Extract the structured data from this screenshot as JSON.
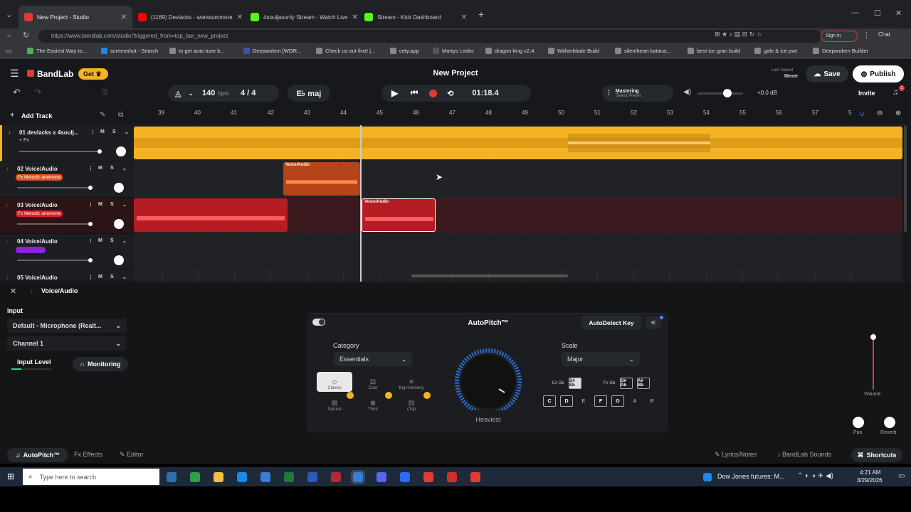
{
  "browser": {
    "tabs": [
      {
        "title": "New Project - Studio",
        "color": "#e53935",
        "active": true
      },
      {
        "title": "(1169) Devlacks - wantsummore",
        "color": "#ff0000"
      },
      {
        "title": "4souljasonly Stream - Watch Live",
        "color": "#53fc18"
      },
      {
        "title": "Stream - Kick Dashboard",
        "color": "#53fc18"
      }
    ],
    "url": "https://www.bandlab.com/studio?triggered_from=top_bar_new_project",
    "signin": "Sign in",
    "chat": "Chat",
    "bookmarks": [
      "The Easiest Way to...",
      "screenshot - Search",
      "to get auto tune b...",
      "Deepwoken [WOR...",
      "Check us out first! |...",
      "cety.app",
      "Martys Leaks",
      "dragon king v2.4",
      "Witherblade Build",
      "silentheart katana...",
      "best ice gran build",
      "gale & ice pve",
      "Deepwoken Builder"
    ]
  },
  "app": {
    "brand": "BandLab",
    "get_label": "Get",
    "project_title": "New Project",
    "last_saved_label": "Last Saved",
    "last_saved_value": "Never",
    "save_label": "Save",
    "publish_label": "Publish",
    "tempo": "140",
    "tempo_unit": "bpm",
    "time_sig": "4 / 4",
    "key": "E♭ maj",
    "time": "01:18.4",
    "mastering_title": "Mastering",
    "mastering_sub": "Select Preset",
    "master_db": "+0.0 dB",
    "invite_label": "Invite",
    "notif_count": "1",
    "add_track_label": "Add Track",
    "ruler": [
      "39",
      "40",
      "41",
      "42",
      "43",
      "44",
      "45",
      "46",
      "47",
      "48",
      "49",
      "50",
      "51",
      "52",
      "53",
      "54",
      "55",
      "56",
      "57",
      "5"
    ],
    "tracks": [
      {
        "name": "01 devlacks x 4soulj...",
        "fx": "+ Fx",
        "fx_color": "",
        "color": "#f5b324"
      },
      {
        "name": "02 Voice/Audio",
        "fx": "Fx Melodic anemone",
        "fx_color": "#e0531f",
        "color": "#e0531f"
      },
      {
        "name": "03 Voice/Audio",
        "fx": "Fx Melodic anemone",
        "fx_color": "#e01f2a",
        "color": "#e01f2a"
      },
      {
        "name": "04 Voice/Audio",
        "fx": "",
        "fx_color": "#8a24d8",
        "color": "#8a24d8"
      },
      {
        "name": "05 Voice/Audio",
        "fx": "",
        "fx_color": "",
        "color": "#2b7be0"
      }
    ],
    "clip_label": "Voice/Audio",
    "ms_m": "M",
    "ms_s": "S"
  },
  "panel": {
    "track_title": "Voice/Audio",
    "input_label": "Input",
    "input_device": "Default - Microphone (Realt...",
    "channel": "Channel 1",
    "input_level_label": "Input Level",
    "monitoring_label": "Monitoring",
    "autopitch_title": "AutoPitch™",
    "autodetect_label": "AutoDetect Key",
    "category_label": "Category",
    "category_value": "Essentials",
    "modes": [
      "Classic",
      "Duet",
      "Big Harmony",
      "Natural",
      "Third",
      "Chip"
    ],
    "dial_label": "Heaviest",
    "scale_label": "Scale",
    "scale_value": "Major",
    "sharps": [
      "C# Db",
      "D# Eb",
      "F# Gb",
      "G# Ab",
      "A# Bb"
    ],
    "naturals": [
      "C",
      "D",
      "E",
      "F",
      "G",
      "A",
      "B"
    ],
    "volume_label": "Volume",
    "pan_label": "Pan",
    "reverb_label": "Reverb"
  },
  "footer": {
    "autopitch_tab": "AutoPitch™",
    "effects_tab": "Effects",
    "editor_tab": "Editor",
    "lyrics_label": "Lyrics/Notes",
    "sounds_label": "BandLab Sounds",
    "shortcuts_label": "Shortcuts"
  },
  "taskbar": {
    "search_placeholder": "Type here to search",
    "news": "Dow Jones futures: M...",
    "time": "4:21 AM",
    "date": "3/29/2026"
  },
  "colors": {
    "track1": "#f5b324",
    "track2": "#e0531f",
    "track3": "#e01f2a",
    "accent": "#e53935"
  }
}
